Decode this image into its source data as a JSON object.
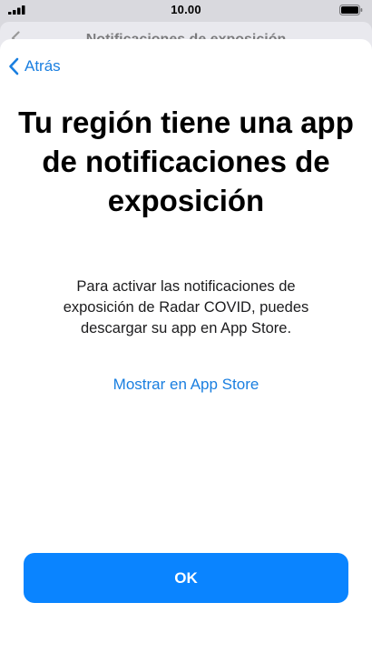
{
  "status_bar": {
    "time": "10.00",
    "signal_icon": "cellular-signal-icon",
    "battery_icon": "battery-icon"
  },
  "background_screen": {
    "title": "Notificaciones de exposición",
    "back_icon": "chevron-left-icon"
  },
  "sheet": {
    "back_label": "Atrás",
    "back_icon": "chevron-left-icon",
    "headline": "Tu región tiene una app de notificaciones de exposición",
    "body": "Para activar las notificaciones de exposición de Radar COVID, puedes descargar su app en App Store.",
    "store_link": "Mostrar en App Store",
    "ok_label": "OK"
  },
  "colors": {
    "accent": "#1a7fe0",
    "button": "#0a84ff",
    "background": "#ffffff"
  }
}
